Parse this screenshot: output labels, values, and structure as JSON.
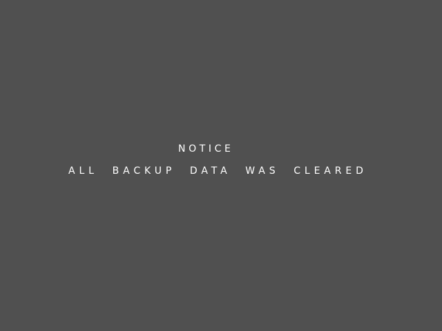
{
  "notice": {
    "title": "NOTICE",
    "message": "ALL  BACKUP  DATA  WAS  CLEARED"
  },
  "colors": {
    "background": "#505050",
    "text": "#ffffff"
  }
}
